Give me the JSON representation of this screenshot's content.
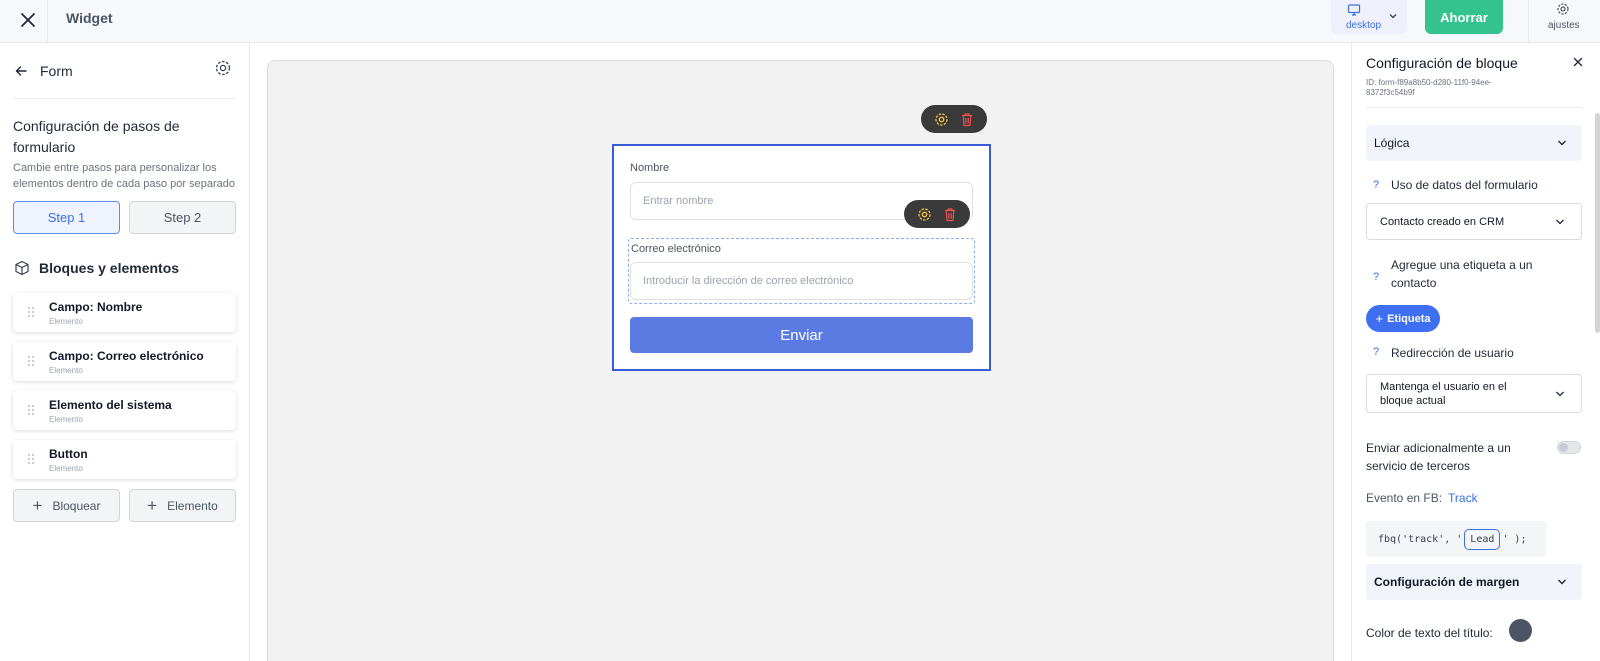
{
  "topbar": {
    "title": "Widget",
    "device_label": "desktop",
    "save_label": "Ahorrar",
    "settings_label": "ajustes"
  },
  "left_panel": {
    "back_label": "Form",
    "steps_heading": "Configuración de pasos de formulario",
    "steps_description": "Cambie entre pasos para personalizar los elementos dentro de cada paso por separado",
    "steps": [
      {
        "label": "Step 1",
        "active": true
      },
      {
        "label": "Step 2",
        "active": false
      }
    ],
    "blocks_heading": "Bloques y elementos",
    "blocks": [
      {
        "title": "Campo: Nombre",
        "subtitle": "Elemento"
      },
      {
        "title": "Campo: Correo electrónico",
        "subtitle": "Elemento"
      },
      {
        "title": "Elemento del sistema",
        "subtitle": "Elemento"
      },
      {
        "title": "Button",
        "subtitle": "Elemento"
      }
    ],
    "add_block_label": "Bloquear",
    "add_element_label": "Elemento"
  },
  "form_preview": {
    "name_label": "Nombre",
    "name_placeholder": "Entrar nombre",
    "email_label": "Correo electrónico",
    "email_placeholder": "Introducir la dirección de correo electrónico",
    "submit_label": "Enviar"
  },
  "right_panel": {
    "title": "Configuración de bloque",
    "block_id": "ID: form-f89a8b50-d280-11f0-94ee-8372f3c54b9f",
    "logic_section": "Lógica",
    "help_glyph": "?",
    "form_data_label": "Uso de datos del formulario",
    "form_data_value": "Contacto creado en CRM",
    "tag_label": "Agregue una etiqueta a un contacto",
    "tag_button": "Etiqueta",
    "redirect_label": "Redirección de usuario",
    "redirect_value": "Mantenga el usuario en el bloque actual",
    "third_party_label": "Enviar adicionalmente a un servicio de terceros",
    "third_party_enabled": false,
    "fb_event_label": "Evento en FB:",
    "fb_event_value": "Track",
    "code_prefix": "fbq('track', '",
    "code_event": "Lead",
    "code_suffix": "' );",
    "margin_section": "Configuración de margen",
    "title_color_label": "Color de texto del título:",
    "title_color": "#4b5563"
  },
  "colors": {
    "accent": "#3b6fe0",
    "save_green": "#34c38f",
    "submit_blue": "#5b7be2",
    "form_border": "#3b5bdb",
    "tag_blue": "#3d6ff0"
  }
}
